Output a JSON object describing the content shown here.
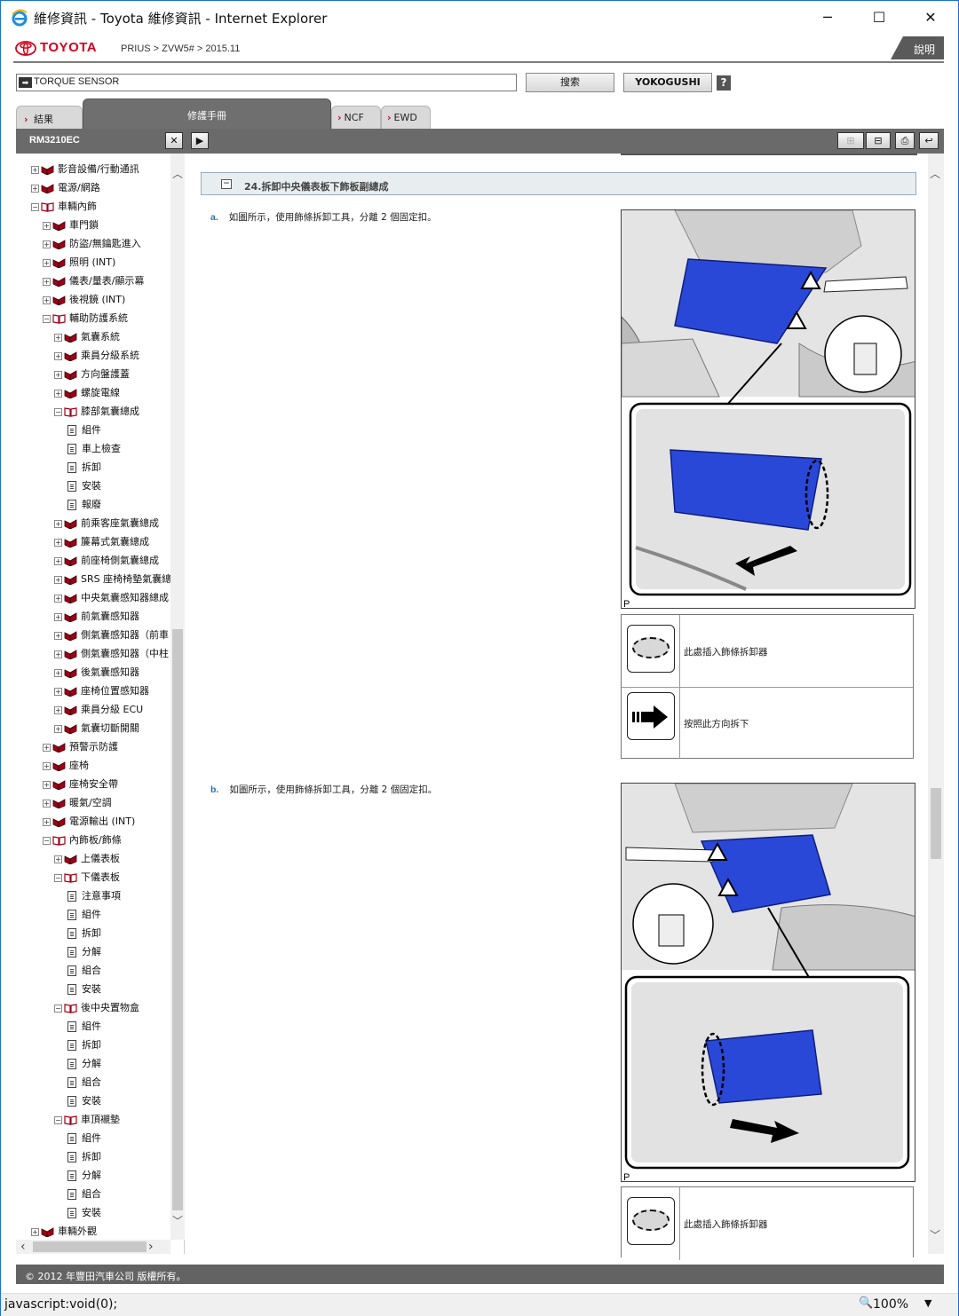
{
  "window": {
    "title": "維修資訊 - Toyota 維修資訊 - Internet Explorer",
    "min": "─",
    "max": "☐",
    "close": "✕"
  },
  "header": {
    "brand": "TOYOTA",
    "breadcrumb": "PRIUS > ZVW5# > 2015.11",
    "help": "說明"
  },
  "search": {
    "value": "TORQUE SENSOR",
    "search_btn": "搜索",
    "yoko_btn": "YOKOGUSHI",
    "help_q": "?"
  },
  "tabs": [
    {
      "label": "結果"
    },
    {
      "label": "修護手冊"
    },
    {
      "label": "NCF"
    },
    {
      "label": "EWD"
    }
  ],
  "toolbar": {
    "doc_id": "RM3210EC",
    "close": "✕",
    "next": "▶"
  },
  "tree": [
    {
      "label": "影音設備/行動通訊",
      "level": 0,
      "type": "book",
      "pm": "+"
    },
    {
      "label": "電源/網路",
      "level": 0,
      "type": "book",
      "pm": "+"
    },
    {
      "label": "車輛內飾",
      "level": 0,
      "type": "open",
      "pm": "−"
    },
    {
      "label": "車門鎖",
      "level": 1,
      "type": "book",
      "pm": "+"
    },
    {
      "label": "防盜/無鑰匙進入",
      "level": 1,
      "type": "book",
      "pm": "+"
    },
    {
      "label": "照明 (INT)",
      "level": 1,
      "type": "book",
      "pm": "+"
    },
    {
      "label": "儀表/量表/顯示幕",
      "level": 1,
      "type": "book",
      "pm": "+"
    },
    {
      "label": "後視鏡 (INT)",
      "level": 1,
      "type": "book",
      "pm": "+"
    },
    {
      "label": "輔助防護系統",
      "level": 1,
      "type": "open",
      "pm": "−"
    },
    {
      "label": "氣囊系統",
      "level": 2,
      "type": "book",
      "pm": "+"
    },
    {
      "label": "乘員分級系統",
      "level": 2,
      "type": "book",
      "pm": "+"
    },
    {
      "label": "方向盤護蓋",
      "level": 2,
      "type": "book",
      "pm": "+"
    },
    {
      "label": "螺旋電線",
      "level": 2,
      "type": "book",
      "pm": "+"
    },
    {
      "label": "膝部氣囊總成",
      "level": 2,
      "type": "open",
      "pm": "−"
    },
    {
      "label": "組件",
      "level": 3,
      "type": "page"
    },
    {
      "label": "車上檢查",
      "level": 3,
      "type": "page"
    },
    {
      "label": "拆卸",
      "level": 3,
      "type": "page"
    },
    {
      "label": "安裝",
      "level": 3,
      "type": "page"
    },
    {
      "label": "報廢",
      "level": 3,
      "type": "page"
    },
    {
      "label": "前乘客座氣囊總成",
      "level": 2,
      "type": "book",
      "pm": "+"
    },
    {
      "label": "簾幕式氣囊總成",
      "level": 2,
      "type": "book",
      "pm": "+"
    },
    {
      "label": "前座椅側氣囊總成",
      "level": 2,
      "type": "book",
      "pm": "+"
    },
    {
      "label": "SRS 座椅椅墊氣囊總",
      "level": 2,
      "type": "book",
      "pm": "+"
    },
    {
      "label": "中央氣囊感知器總成",
      "level": 2,
      "type": "book",
      "pm": "+"
    },
    {
      "label": "前氣囊感知器",
      "level": 2,
      "type": "book",
      "pm": "+"
    },
    {
      "label": "側氣囊感知器（前車",
      "level": 2,
      "type": "book",
      "pm": "+"
    },
    {
      "label": "側氣囊感知器（中柱",
      "level": 2,
      "type": "book",
      "pm": "+"
    },
    {
      "label": "後氣囊感知器",
      "level": 2,
      "type": "book",
      "pm": "+"
    },
    {
      "label": "座椅位置感知器",
      "level": 2,
      "type": "book",
      "pm": "+"
    },
    {
      "label": "乘員分級 ECU",
      "level": 2,
      "type": "book",
      "pm": "+"
    },
    {
      "label": "氣囊切斷開關",
      "level": 2,
      "type": "book",
      "pm": "+"
    },
    {
      "label": "預警示防護",
      "level": 1,
      "type": "book",
      "pm": "+"
    },
    {
      "label": "座椅",
      "level": 1,
      "type": "book",
      "pm": "+"
    },
    {
      "label": "座椅安全帶",
      "level": 1,
      "type": "book",
      "pm": "+"
    },
    {
      "label": "暖氣/空調",
      "level": 1,
      "type": "book",
      "pm": "+"
    },
    {
      "label": "電源輸出 (INT)",
      "level": 1,
      "type": "book",
      "pm": "+"
    },
    {
      "label": "內飾板/飾條",
      "level": 1,
      "type": "open",
      "pm": "−"
    },
    {
      "label": "上儀表板",
      "level": 2,
      "type": "book",
      "pm": "+"
    },
    {
      "label": "下儀表板",
      "level": 2,
      "type": "open",
      "pm": "−"
    },
    {
      "label": "注意事項",
      "level": 3,
      "type": "page"
    },
    {
      "label": "組件",
      "level": 3,
      "type": "page"
    },
    {
      "label": "拆卸",
      "level": 3,
      "type": "page"
    },
    {
      "label": "分解",
      "level": 3,
      "type": "page"
    },
    {
      "label": "組合",
      "level": 3,
      "type": "page"
    },
    {
      "label": "安裝",
      "level": 3,
      "type": "page"
    },
    {
      "label": "後中央置物盒",
      "level": 2,
      "type": "open",
      "pm": "−"
    },
    {
      "label": "組件",
      "level": 3,
      "type": "page"
    },
    {
      "label": "拆卸",
      "level": 3,
      "type": "page"
    },
    {
      "label": "分解",
      "level": 3,
      "type": "page"
    },
    {
      "label": "組合",
      "level": 3,
      "type": "page"
    },
    {
      "label": "安裝",
      "level": 3,
      "type": "page"
    },
    {
      "label": "車頂襯墊",
      "level": 2,
      "type": "open",
      "pm": "−"
    },
    {
      "label": "組件",
      "level": 3,
      "type": "page"
    },
    {
      "label": "拆卸",
      "level": 3,
      "type": "page"
    },
    {
      "label": "分解",
      "level": 3,
      "type": "page"
    },
    {
      "label": "組合",
      "level": 3,
      "type": "page"
    },
    {
      "label": "安裝",
      "level": 3,
      "type": "page"
    },
    {
      "label": "車輛外觀",
      "level": 0,
      "type": "book",
      "pm": "+"
    }
  ],
  "content": {
    "section_title": "24.拆卸中央儀表板下飾板副總成",
    "section_toggle": "−",
    "step_a_num": "a.",
    "step_a_text": "如圖所示，使用飾條拆卸工具，分離 2 個固定扣。",
    "step_b_num": "b.",
    "step_b_text": "如圖所示，使用飾條拆卸工具，分離 2 個固定扣。",
    "fig_label": "P",
    "legend_insert": "此處插入飾條拆卸器",
    "legend_direction": "按照此方向拆下"
  },
  "footer": {
    "copyright": "© 2012 年豐田汽車公司 版權所有。"
  },
  "status": {
    "text": "javascript:void(0);",
    "zoom": "100%"
  },
  "colors": {
    "brand_red": "#d6001c",
    "part_blue": "#2040d0",
    "toolbar_gray": "#6a6a6a"
  }
}
